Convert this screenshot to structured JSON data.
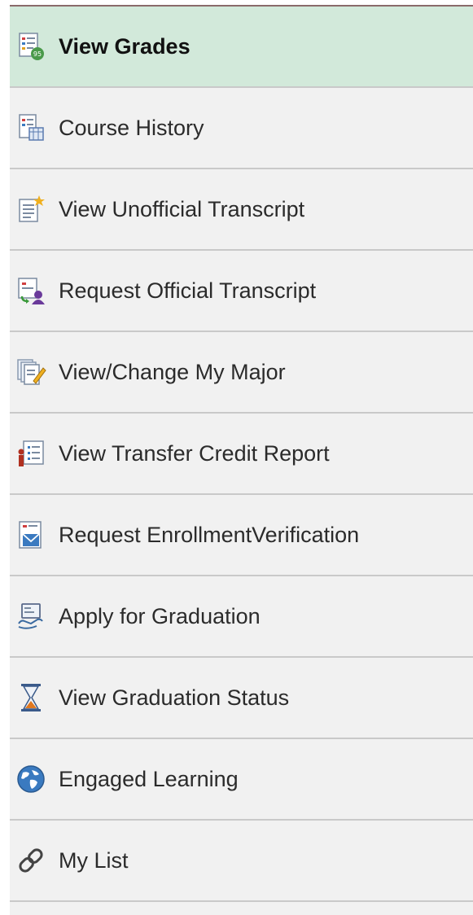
{
  "menu": {
    "items": [
      {
        "label": "View Grades",
        "icon": "grades-icon",
        "active": true
      },
      {
        "label": "Course History",
        "icon": "course-history-icon"
      },
      {
        "label": "View Unofficial Transcript",
        "icon": "unofficial-transcript-icon"
      },
      {
        "label": "Request Official Transcript",
        "icon": "official-transcript-icon"
      },
      {
        "label": "View/Change My Major",
        "icon": "change-major-icon"
      },
      {
        "label": "View Transfer Credit Report",
        "icon": "transfer-credit-icon"
      },
      {
        "label": "Request EnrollmentVerification",
        "icon": "enrollment-verification-icon"
      },
      {
        "label": "Apply for Graduation",
        "icon": "apply-graduation-icon"
      },
      {
        "label": "View Graduation Status",
        "icon": "hourglass-icon"
      },
      {
        "label": "Engaged Learning",
        "icon": "globe-icon"
      },
      {
        "label": "My List",
        "icon": "link-icon"
      }
    ],
    "active_bg": "#d2e9da",
    "item_bg": "#f1f1f1"
  }
}
